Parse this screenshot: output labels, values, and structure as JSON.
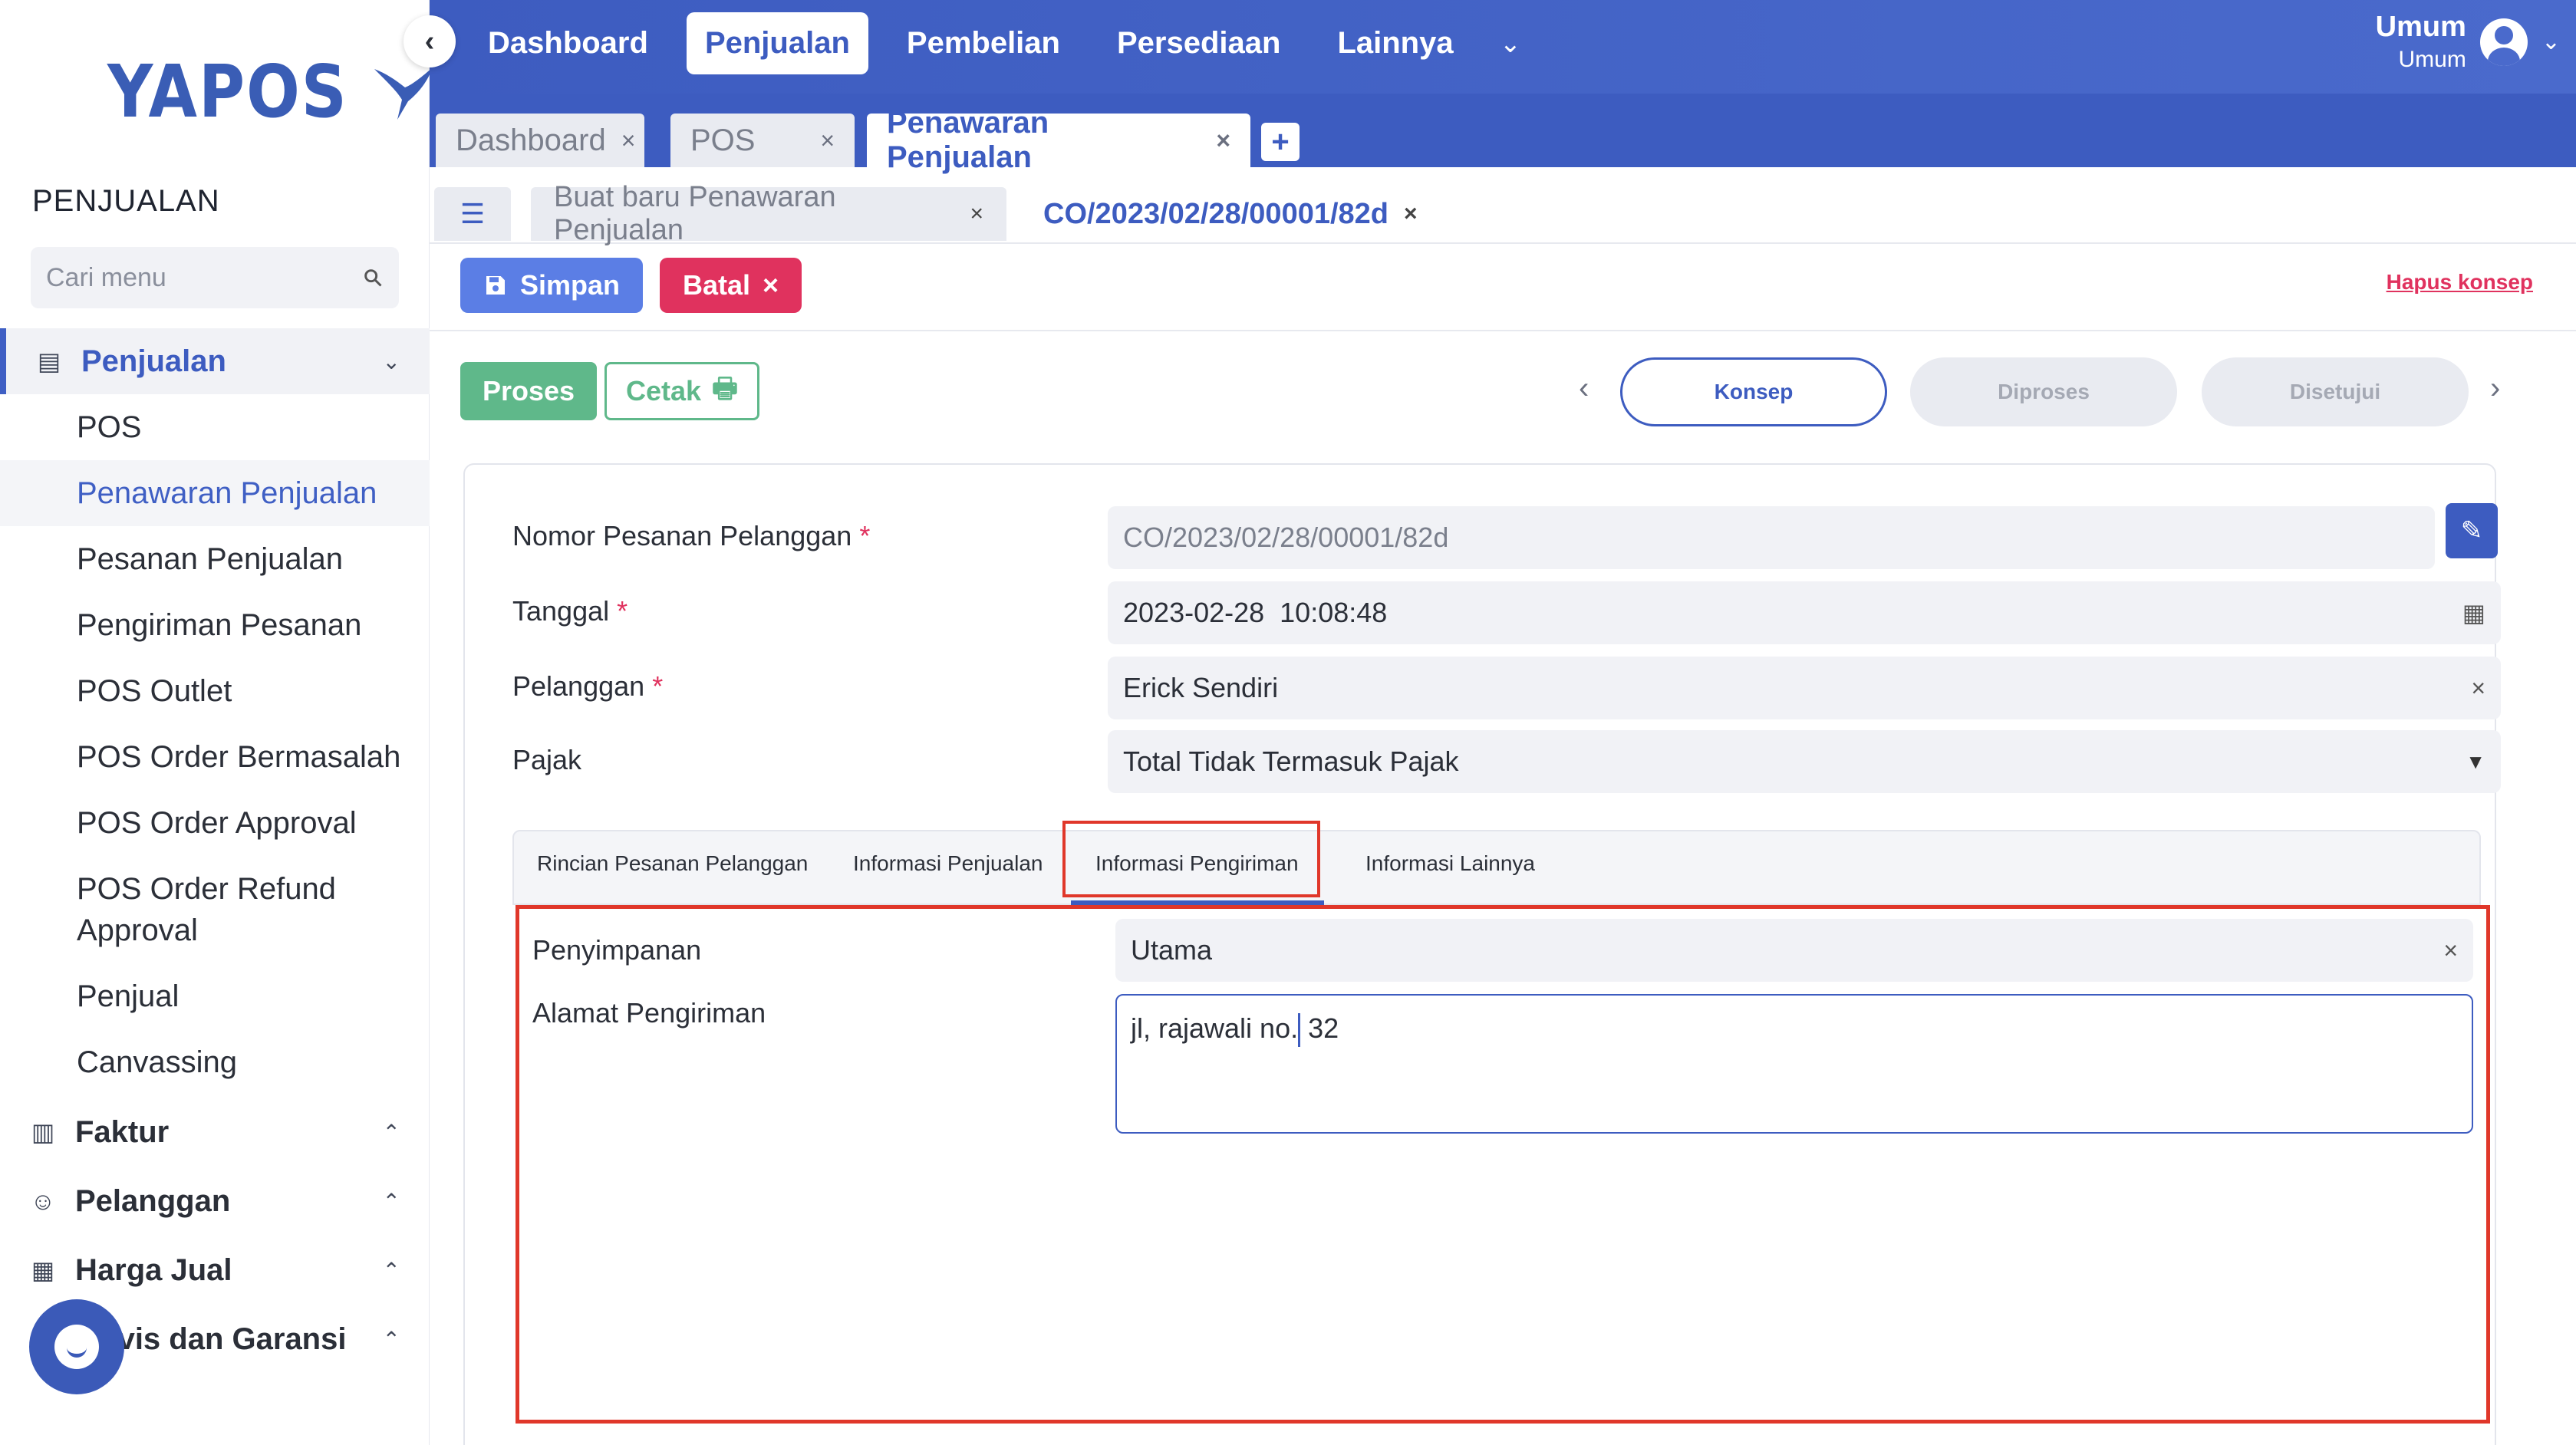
{
  "sidebar": {
    "logo_text": "YAPOS",
    "section_title": "PENJUALAN",
    "search_placeholder": "Cari menu",
    "groups": [
      {
        "label": "Penjualan",
        "icon": "receipt-icon"
      },
      {
        "label": "Faktur",
        "icon": "invoice-icon"
      },
      {
        "label": "Pelanggan",
        "icon": "customer-icon"
      },
      {
        "label": "Harga Jual",
        "icon": "price-icon"
      },
      {
        "label": "rvis dan Garansi",
        "icon": "service-icon"
      }
    ],
    "subitems": [
      "POS",
      "Penawaran Penjualan",
      "Pesanan Penjualan",
      "Pengiriman Pesanan",
      "POS Outlet",
      "POS Order Bermasalah",
      "POS Order Approval",
      "POS Order Refund",
      "Approval",
      "Penjual",
      "Canvassing"
    ]
  },
  "topnav": {
    "items": [
      "Dashboard",
      "Penjualan",
      "Pembelian",
      "Persediaan",
      "Lainnya"
    ],
    "active": "Penjualan"
  },
  "user": {
    "name": "Umum",
    "sub": "Umum"
  },
  "doctabs": {
    "items": [
      "Dashboard",
      "POS",
      "Penawaran Penjualan"
    ],
    "plus": "+"
  },
  "subtabs": {
    "items": [
      "Buat baru Penawaran Penjualan",
      "CO/2023/02/28/00001/82d"
    ]
  },
  "actions": {
    "save": "Simpan",
    "cancel": "Batal",
    "delete_draft": "Hapus konsep",
    "process": "Proses",
    "print": "Cetak"
  },
  "status_steps": [
    "Konsep",
    "Diproses",
    "Disetujui"
  ],
  "form": {
    "order_number_label": "Nomor Pesanan Pelanggan",
    "order_number_value": "CO/2023/02/28/00001/82d",
    "date_label": "Tanggal",
    "date_value": "2023-02-28  10:08:48",
    "customer_label": "Pelanggan",
    "customer_value": "Erick Sendiri",
    "tax_label": "Pajak",
    "tax_value": "Total Tidak Termasuk Pajak",
    "required_mark": "*"
  },
  "inner_tabs": [
    "Rincian Pesanan Pelanggan",
    "Informasi Penjualan",
    "Informasi Pengiriman",
    "Informasi Lainnya"
  ],
  "shipping": {
    "storage_label": "Penyimpanan",
    "storage_value": "Utama",
    "address_label": "Alamat Pengiriman",
    "address_before_caret": "jl, rajawali no.",
    "address_after_caret": " 32"
  },
  "colors": {
    "primary": "#3d5cc0",
    "danger": "#e0325e",
    "success": "#5fb88a",
    "highlight": "#e0372a"
  }
}
